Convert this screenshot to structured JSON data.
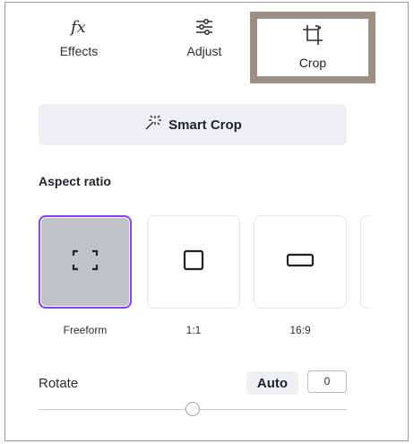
{
  "tabs": [
    {
      "label": "Effects",
      "icon": "fx-icon"
    },
    {
      "label": "Adjust",
      "icon": "sliders-icon"
    },
    {
      "label": "Crop",
      "icon": "crop-icon",
      "active": true
    }
  ],
  "smart_crop": {
    "label": "Smart Crop",
    "icon": "magic-wand-icon"
  },
  "aspect_ratio": {
    "title": "Aspect ratio",
    "options": [
      {
        "label": "Freeform",
        "selected": true
      },
      {
        "label": "1:1"
      },
      {
        "label": "16:9"
      }
    ]
  },
  "rotate": {
    "label": "Rotate",
    "auto_label": "Auto",
    "value": "0",
    "slider_fraction": 0.5
  },
  "colors": {
    "selected_border": "#8b3dff",
    "highlight_box": "#9c8f82"
  }
}
